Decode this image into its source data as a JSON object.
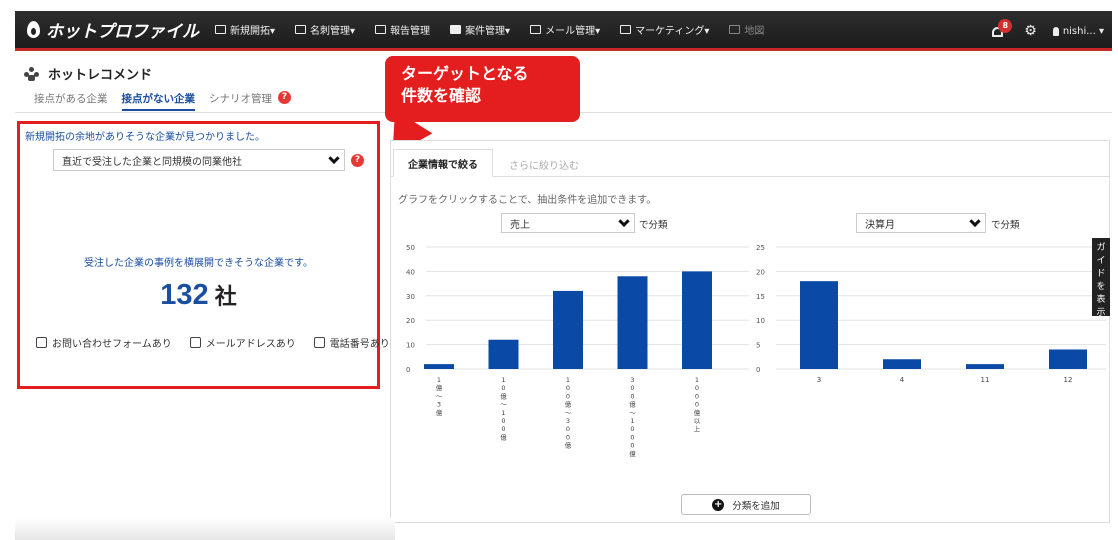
{
  "header": {
    "logo_text": "ホットプロファイル",
    "nav": [
      {
        "label": "新規開拓▾",
        "icon": "search-doc-icon"
      },
      {
        "label": "名刺管理▾",
        "icon": "card-icon"
      },
      {
        "label": "報告管理",
        "icon": "edit-icon"
      },
      {
        "label": "案件管理▾",
        "icon": "briefcase-icon"
      },
      {
        "label": "メール管理▾",
        "icon": "mail-icon"
      },
      {
        "label": "マーケティング▾",
        "icon": "megaphone-icon"
      },
      {
        "label": "地図",
        "icon": "map-icon"
      }
    ],
    "notification_count": "8",
    "user_label": "nishi... ▾"
  },
  "page": {
    "title": "ホットレコメンド",
    "tabs": [
      "接点がある企業",
      "接点がない企業",
      "シナリオ管理"
    ],
    "help_glyph": "?"
  },
  "callout": {
    "line1": "ターゲットとなる",
    "line2": "件数を確認"
  },
  "left": {
    "message": "新規開拓の余地がありそうな企業が見つかりました。",
    "select_value": "直近で受注した企業と同規模の同業他社",
    "description": "受注した企業の事例を横展開できそうな企業です。",
    "count": "132",
    "count_unit": "社",
    "checkboxes": [
      "お問い合わせフォームあり",
      "メールアドレスあり",
      "電話番号あり"
    ]
  },
  "right": {
    "tabs": [
      "企業情報で絞る",
      "さらに絞り込む"
    ],
    "hint": "グラフをクリックすることで、抽出条件を追加できます。",
    "suffix": "で分類",
    "add_button": "分類を追加",
    "guide_text": "ガイドを表示"
  },
  "chart_data": [
    {
      "type": "bar",
      "select_label": "売上",
      "categories": [
        "1億〜3億",
        "10億〜100億",
        "100億〜300億",
        "300億〜1000億",
        "1000億以上"
      ],
      "values": [
        2,
        12,
        32,
        38,
        40
      ],
      "ylim": [
        0,
        50
      ],
      "yticks": [
        0,
        10,
        20,
        30,
        40,
        50
      ],
      "color": "#0a4aa6"
    },
    {
      "type": "bar",
      "select_label": "決算月",
      "categories": [
        "3",
        "4",
        "11",
        "12"
      ],
      "values": [
        18,
        2,
        1,
        4
      ],
      "ylim": [
        0,
        25
      ],
      "yticks": [
        0,
        5,
        10,
        15,
        20,
        25
      ],
      "color": "#0a4aa6"
    }
  ]
}
